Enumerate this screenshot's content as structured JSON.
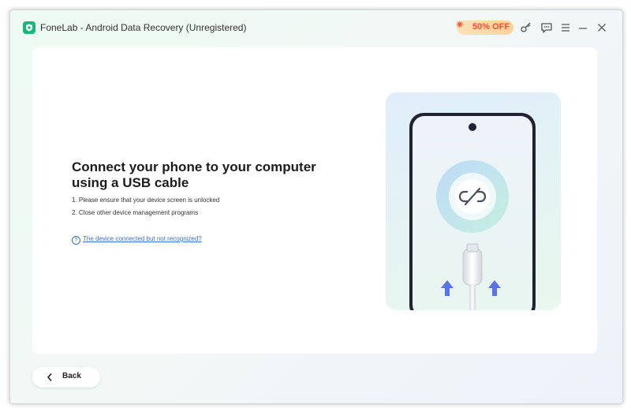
{
  "window": {
    "title": "FoneLab - Android Data Recovery (Unregistered)",
    "logo_icon": "shield-plus-icon"
  },
  "titlebar": {
    "promo_label": "50% OFF",
    "promo_icon": "gift-icon",
    "buttons": [
      {
        "name": "key-icon"
      },
      {
        "name": "chat-icon"
      },
      {
        "name": "menu-icon"
      },
      {
        "name": "minimize-icon"
      },
      {
        "name": "close-icon"
      }
    ]
  },
  "main": {
    "headline": "Connect your phone to your computer using a USB cable",
    "steps": [
      "1. Please ensure that your device screen is unlocked",
      "2. Close other device management programs"
    ],
    "help_link": "The device connected but not recognized?",
    "illustration": {
      "center_icon": "disconnected-link-icon",
      "cable_icon": "usb-cable-icon",
      "arrow_icon": "arrow-up-icon"
    }
  },
  "footer": {
    "back_label": "Back",
    "back_icon": "chevron-left-icon"
  },
  "colors": {
    "brand_green": "#19b878",
    "link_blue": "#3b6bd6",
    "promo_red": "#ff4a2e",
    "arrow_blue": "#5a74e8"
  }
}
